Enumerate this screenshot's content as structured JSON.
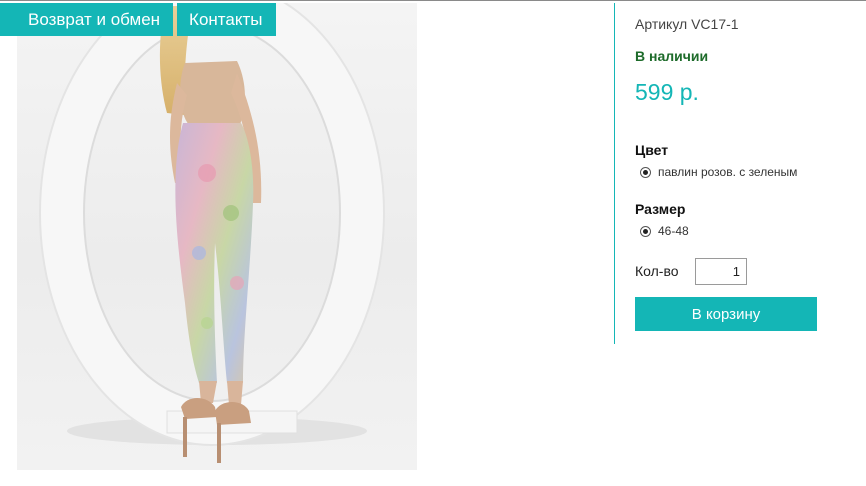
{
  "nav": {
    "tabs": [
      {
        "label": "Возврат и обмен"
      },
      {
        "label": "Контакты"
      }
    ]
  },
  "product": {
    "sku": "Артикул VC17-1",
    "stock": "В наличии",
    "price": "599 р.",
    "color": {
      "title": "Цвет",
      "options": [
        {
          "label": "павлин розов. с зеленым",
          "selected": true
        }
      ]
    },
    "size": {
      "title": "Размер",
      "options": [
        {
          "label": "46-48",
          "selected": true
        }
      ]
    },
    "quantity": {
      "label": "Кол-во",
      "value": "1"
    },
    "add_to_cart_label": "В корзину"
  },
  "colors": {
    "accent": "#14b6b6",
    "stock_green": "#1d6b2a"
  }
}
